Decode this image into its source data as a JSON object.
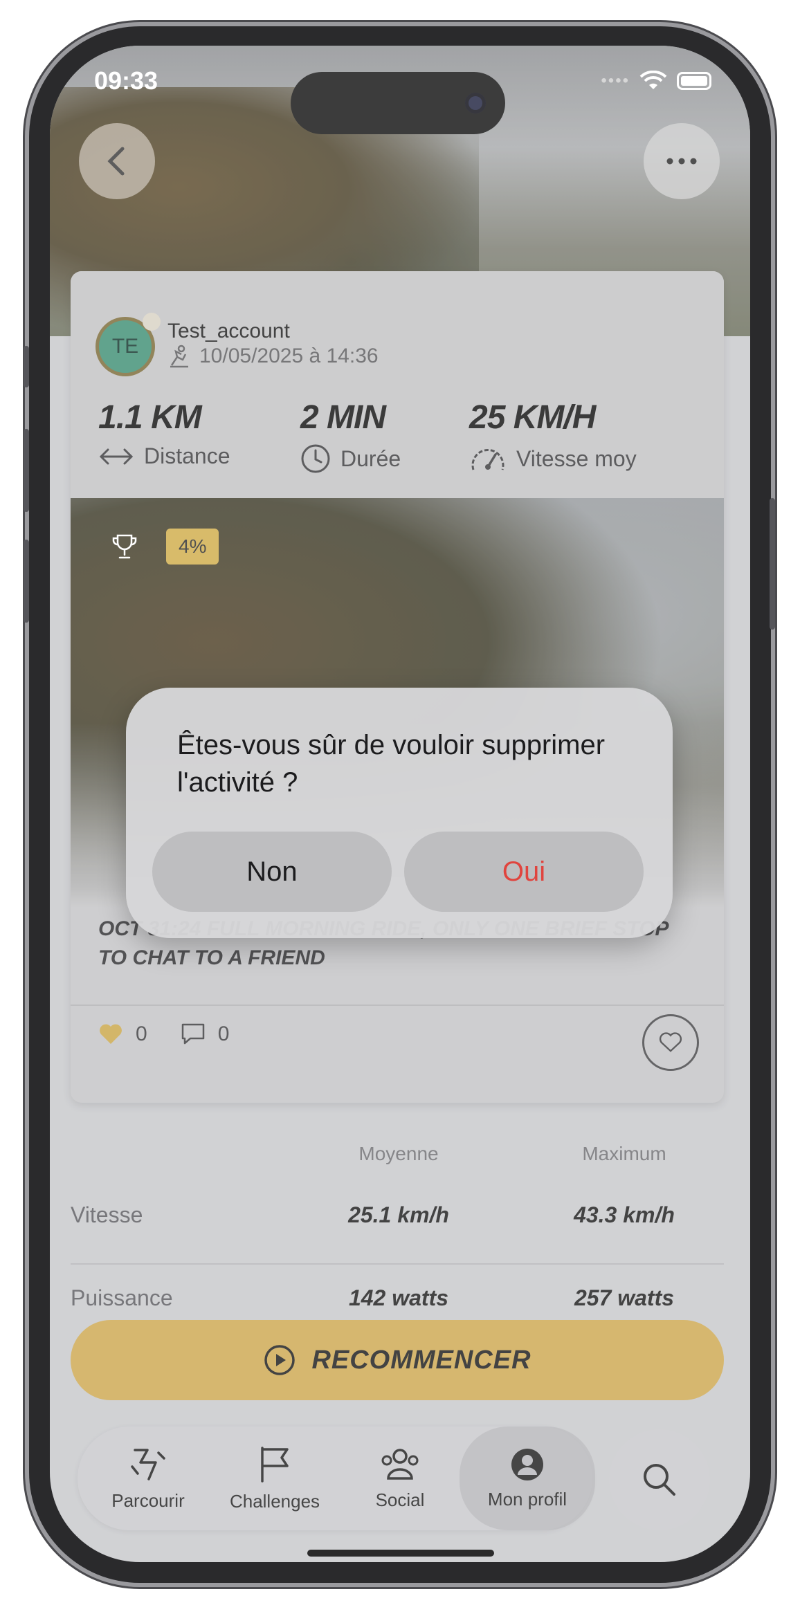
{
  "status_bar": {
    "time": "09:33"
  },
  "activity": {
    "username": "Test_account",
    "avatar_initials": "TE",
    "datetime": "10/05/2025 à 14:36",
    "stats": [
      {
        "value": "1.1 KM",
        "label": "Distance",
        "icon": "arrows-horizontal-icon"
      },
      {
        "value": "2 MIN",
        "label": "Durée",
        "icon": "clock-icon"
      },
      {
        "value": "25 KM/H",
        "label": "Vitesse moy",
        "icon": "speedometer-icon"
      }
    ],
    "percent_badge": "4%",
    "description": "Oct 31:24 Full morning ride, only one brief stop to chat to a friend",
    "likes": "0",
    "comments": "0"
  },
  "stats_table": {
    "col_avg": "Moyenne",
    "col_max": "Maximum",
    "rows": [
      {
        "label": "Vitesse",
        "avg": "25.1 km/h",
        "max": "43.3 km/h"
      },
      {
        "label": "Puissance",
        "avg": "142 watts",
        "max": "257  watts"
      }
    ]
  },
  "restart_label": "RECOMMENCER",
  "tabs": [
    {
      "label": "Parcourir",
      "icon": "route-icon"
    },
    {
      "label": "Challenges",
      "icon": "flag-icon"
    },
    {
      "label": "Social",
      "icon": "people-icon"
    },
    {
      "label": "Mon profil",
      "icon": "profile-icon"
    }
  ],
  "dialog": {
    "message": "Êtes-vous sûr de vouloir supprimer l'activité ?",
    "no_label": "Non",
    "yes_label": "Oui"
  },
  "colors": {
    "accent": "#cda850",
    "danger": "#e0443e"
  }
}
